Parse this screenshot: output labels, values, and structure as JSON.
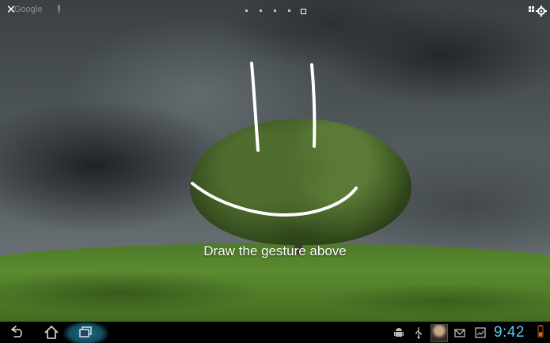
{
  "topbar": {
    "close_label": "✕",
    "google_label": "Google",
    "page_count": 5,
    "current_page": 5
  },
  "gesture_prompt": "Draw the gesture above",
  "statusbar": {
    "time": "9:42"
  },
  "colors": {
    "clock": "#5fc8f0",
    "recent_highlight": "#1f6f8a",
    "stroke": "#ffffff"
  },
  "icons": {
    "close": "close-icon",
    "mic": "microphone-icon",
    "app_menu": "app-menu-icon",
    "back": "back-icon",
    "home": "home-icon",
    "recent": "recent-apps-icon",
    "android": "android-debug-icon",
    "usb": "usb-icon",
    "avatar": "contact-avatar-icon",
    "gmail": "gmail-icon",
    "screenshot": "screenshot-icon",
    "battery": "battery-icon"
  }
}
